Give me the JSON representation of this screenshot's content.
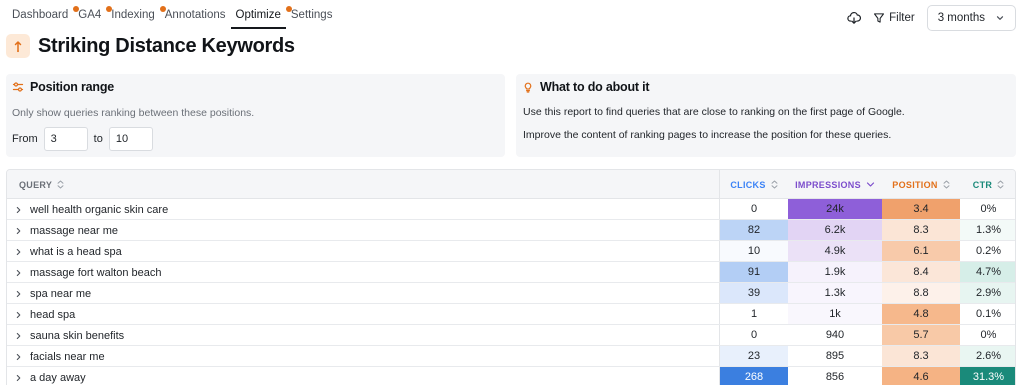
{
  "nav": {
    "tabs": [
      {
        "label": "Dashboard",
        "dot": false,
        "active": false
      },
      {
        "label": "GA4",
        "dot": true,
        "active": false
      },
      {
        "label": "Indexing",
        "dot": true,
        "active": false
      },
      {
        "label": "Annotations",
        "dot": true,
        "active": false
      },
      {
        "label": "Optimize",
        "dot": false,
        "active": true
      },
      {
        "label": "Settings",
        "dot": true,
        "active": false
      }
    ],
    "filter_label": "Filter",
    "period_value": "3 months"
  },
  "page": {
    "title": "Striking Distance Keywords",
    "title_icon": "arrow-up-icon"
  },
  "position_range": {
    "heading": "Position range",
    "description": "Only show queries ranking between these positions.",
    "from_label": "From",
    "from_value": "3",
    "to_label": "to",
    "to_value": "10"
  },
  "what_to_do": {
    "heading": "What to do about it",
    "line1": "Use this report to find queries that are close to ranking on the first page of Google.",
    "line2": "Improve the content of ranking pages to increase the position for these queries."
  },
  "table": {
    "headers": {
      "query": "QUERY",
      "clicks": "CLICKS",
      "impressions": "IMPRESSIONS",
      "position": "POSITION",
      "ctr": "CTR"
    },
    "rows": [
      {
        "query": "well health organic skin care",
        "clicks": "0",
        "impressions": "24k",
        "position": "3.4",
        "ctr": "0%"
      },
      {
        "query": "massage near me",
        "clicks": "82",
        "impressions": "6.2k",
        "position": "8.3",
        "ctr": "1.3%"
      },
      {
        "query": "what is a head spa",
        "clicks": "10",
        "impressions": "4.9k",
        "position": "6.1",
        "ctr": "0.2%"
      },
      {
        "query": "massage fort walton beach",
        "clicks": "91",
        "impressions": "1.9k",
        "position": "8.4",
        "ctr": "4.7%"
      },
      {
        "query": "spa near me",
        "clicks": "39",
        "impressions": "1.3k",
        "position": "8.8",
        "ctr": "2.9%"
      },
      {
        "query": "head spa",
        "clicks": "1",
        "impressions": "1k",
        "position": "4.8",
        "ctr": "0.1%"
      },
      {
        "query": "sauna skin benefits",
        "clicks": "0",
        "impressions": "940",
        "position": "5.7",
        "ctr": "0%"
      },
      {
        "query": "facials near me",
        "clicks": "23",
        "impressions": "895",
        "position": "8.3",
        "ctr": "2.6%"
      },
      {
        "query": "a day away",
        "clicks": "268",
        "impressions": "856",
        "position": "4.6",
        "ctr": "31.3%"
      }
    ]
  },
  "colors": {
    "accent_orange": "#e2701a",
    "clicks_blue": "#3b82f6",
    "impressions_purple": "#8e5fd9",
    "position_orange": "#f0a16c",
    "ctr_teal": "#1a8a7a"
  }
}
